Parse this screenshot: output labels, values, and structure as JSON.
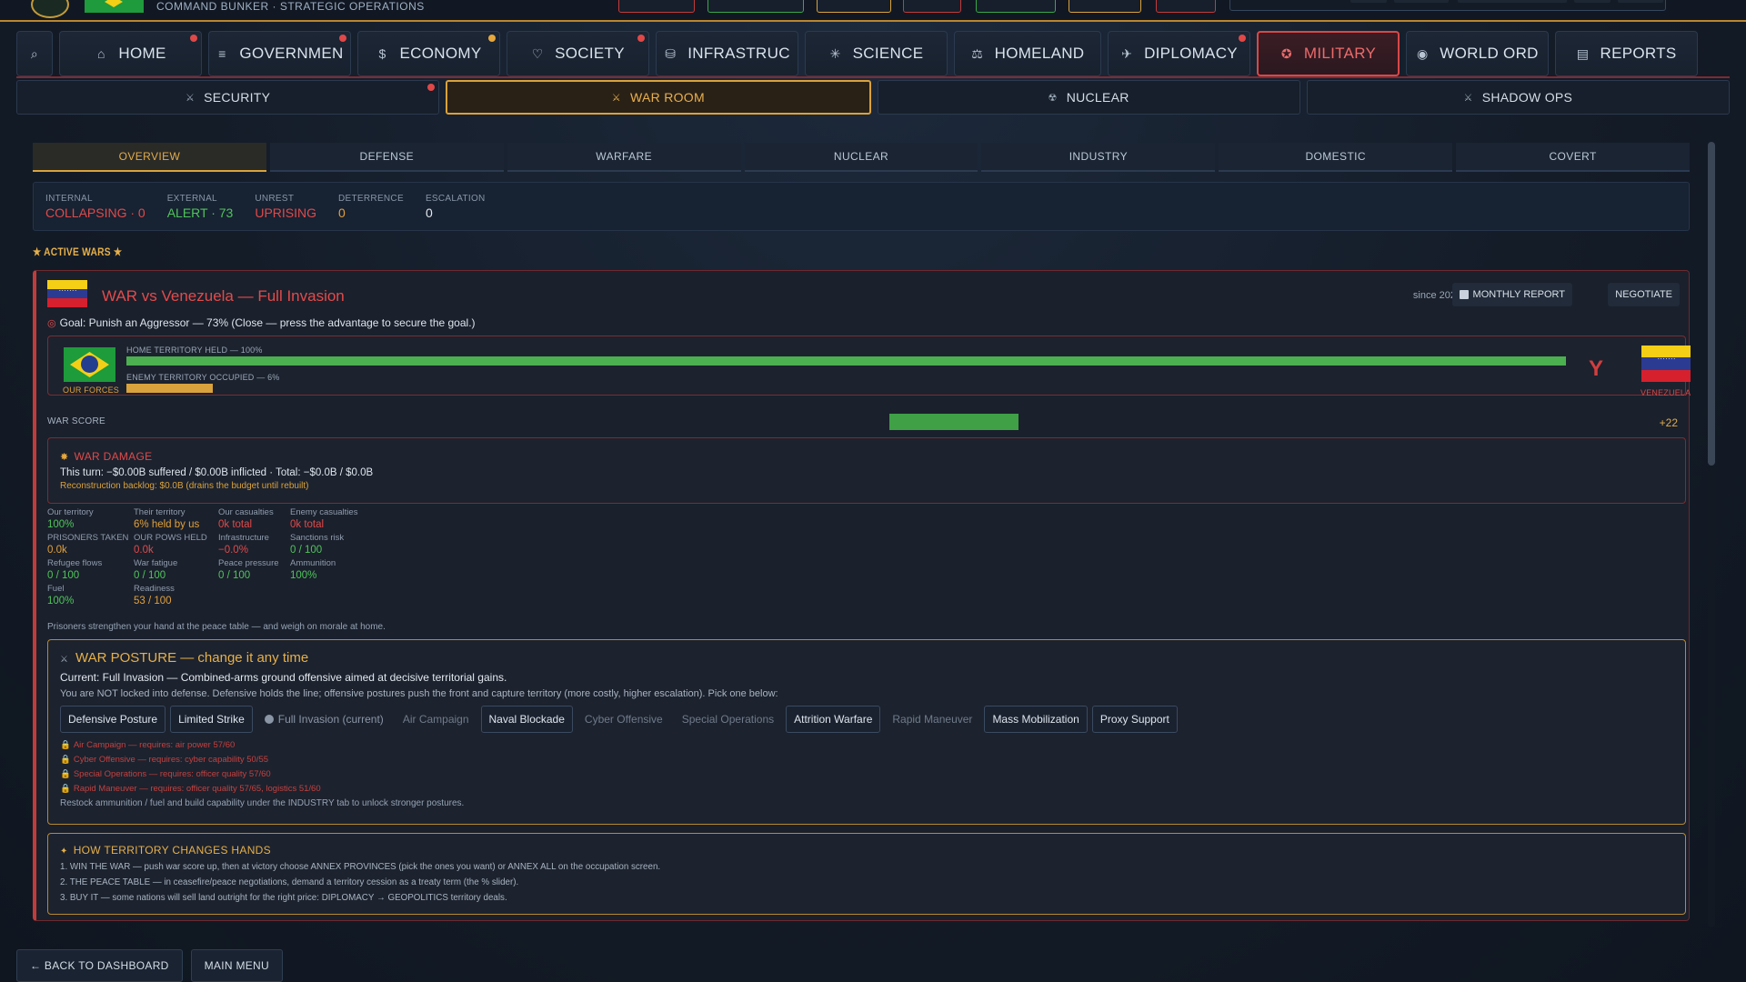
{
  "header": {
    "subtitle": "COMMAND BUNKER · STRATEGIC OPERATIONS",
    "chip_colors": [
      "#c23b3b",
      "#3aa64a",
      "#d9a23c",
      "#c23b3b",
      "#3aa64a",
      "#d9a23c",
      "#c23b3b"
    ]
  },
  "main_nav": {
    "search_icon": "search-icon",
    "items": [
      {
        "id": "home",
        "label": "HOME",
        "icon": "home-icon",
        "glyph": "⌂",
        "alert": "red"
      },
      {
        "id": "government",
        "label": "GOVERNMEN",
        "icon": "menu-icon",
        "glyph": "≡",
        "alert": "red"
      },
      {
        "id": "economy",
        "label": "ECONOMY",
        "icon": "dollar-icon",
        "glyph": "$",
        "alert": "amber"
      },
      {
        "id": "society",
        "label": "SOCIETY",
        "icon": "heart-icon",
        "glyph": "♡",
        "alert": "red"
      },
      {
        "id": "infrastructure",
        "label": "INFRASTRUC",
        "icon": "database-icon",
        "glyph": "⛁",
        "alert": ""
      },
      {
        "id": "science",
        "label": "SCIENCE",
        "icon": "atom-icon",
        "glyph": "✳",
        "alert": ""
      },
      {
        "id": "homeland",
        "label": "HOMELAND",
        "icon": "scales-icon",
        "glyph": "⚖",
        "alert": ""
      },
      {
        "id": "diplomacy",
        "label": "DIPLOMACY",
        "icon": "plane-icon",
        "glyph": "✈",
        "alert": "red"
      },
      {
        "id": "military",
        "label": "MILITARY",
        "icon": "target-icon",
        "glyph": "✪",
        "alert": "",
        "active": true
      },
      {
        "id": "world_order",
        "label": "WORLD ORD",
        "icon": "globe-icon",
        "glyph": "◉",
        "alert": ""
      },
      {
        "id": "reports",
        "label": "REPORTS",
        "icon": "document-icon",
        "glyph": "▤",
        "alert": ""
      }
    ]
  },
  "sub_nav": {
    "items": [
      {
        "id": "security",
        "label": "SECURITY",
        "icon": "swords-icon",
        "glyph": "⚔",
        "alert": "red"
      },
      {
        "id": "war_room",
        "label": "WAR ROOM",
        "icon": "swords-icon",
        "glyph": "⚔",
        "active": true
      },
      {
        "id": "nuclear",
        "label": "NUCLEAR",
        "icon": "radiation-icon",
        "glyph": "☢"
      },
      {
        "id": "shadow_ops",
        "label": "SHADOW OPS",
        "icon": "swords-icon",
        "glyph": "⚔"
      }
    ]
  },
  "tabs": [
    "OVERVIEW",
    "DEFENSE",
    "WARFARE",
    "NUCLEAR",
    "INDUSTRY",
    "DOMESTIC",
    "COVERT"
  ],
  "active_tab": "OVERVIEW",
  "status": [
    {
      "label": "INTERNAL",
      "value": "COLLAPSING · 0",
      "color": "red"
    },
    {
      "label": "EXTERNAL",
      "value": "ALERT · 73",
      "color": "green"
    },
    {
      "label": "UNREST",
      "value": "UPRISING",
      "color": "red"
    },
    {
      "label": "DETERRENCE",
      "value": "0",
      "color": "amber"
    },
    {
      "label": "ESCALATION",
      "value": "0",
      "color": "white"
    }
  ],
  "active_wars_label": "★ ACTIVE WARS ★",
  "war": {
    "title": "WAR vs Venezuela — Full Invasion",
    "since": "since 2029-01",
    "monthly_report_label": "MONTHLY REPORT",
    "negotiate_label": "NEGOTIATE",
    "goal": "Goal: Punish an Aggressor — 73% (Close — press the advantage to secure the goal.)",
    "our_forces_label": "OUR FORCES",
    "enemy_name": "VENEZUELA",
    "home_territory_label": "HOME TERRITORY HELD — 100%",
    "home_territory_pct": 100,
    "enemy_territory_label": "ENEMY TERRITORY OCCUPIED — 6%",
    "enemy_territory_pct": 6,
    "vs_mark": "Y",
    "war_score_label": "WAR SCORE",
    "war_score_value": "+22",
    "war_score_num": 22,
    "damage": {
      "header": "WAR DAMAGE",
      "this_turn": "This turn: −$0.00B suffered / $0.00B inflicted   ·   Total: −$0.0B / $0.0B",
      "backlog": "Reconstruction backlog: $0.0B (drains the budget until rebuilt)"
    },
    "stats": [
      {
        "k": "Our territory",
        "v": "100%",
        "c": "green"
      },
      {
        "k": "Their territory",
        "v": "6% held by us",
        "c": "amber"
      },
      {
        "k": "Our casualties",
        "v": "0k total",
        "c": "red"
      },
      {
        "k": "Enemy casualties",
        "v": "0k total",
        "c": "red"
      },
      {
        "k": "PRISONERS TAKEN",
        "v": "0.0k",
        "c": "amber"
      },
      {
        "k": "OUR POWS HELD",
        "v": "0.0k",
        "c": "red"
      },
      {
        "k": "Infrastructure",
        "v": "−0.0%",
        "c": "red"
      },
      {
        "k": "Sanctions risk",
        "v": "0 / 100",
        "c": "green"
      },
      {
        "k": "Refugee flows",
        "v": "0 / 100",
        "c": "green"
      },
      {
        "k": "War fatigue",
        "v": "0 / 100",
        "c": "green"
      },
      {
        "k": "Peace pressure",
        "v": "0 / 100",
        "c": "green"
      },
      {
        "k": "Ammunition",
        "v": "100%",
        "c": "green"
      },
      {
        "k": "Fuel",
        "v": "100%",
        "c": "green"
      },
      {
        "k": "Readiness",
        "v": "53 / 100",
        "c": "amber"
      }
    ],
    "prisoners_note": "Prisoners strengthen your hand at the peace table — and weigh on morale at home.",
    "posture": {
      "header": "WAR POSTURE — change it any time",
      "current": "Current: Full Invasion — Combined-arms ground offensive aimed at decisive territorial gains.",
      "note": "You are NOT locked into defense. Defensive holds the line; offensive postures push the front and capture territory (more costly, higher escalation). Pick one below:",
      "options": [
        {
          "label": "Defensive Posture",
          "state": "on"
        },
        {
          "label": "Limited Strike",
          "state": "on"
        },
        {
          "label": "Full Invasion (current)",
          "state": "current"
        },
        {
          "label": "Air Campaign",
          "state": "off"
        },
        {
          "label": "Naval Blockade",
          "state": "on"
        },
        {
          "label": "Cyber Offensive",
          "state": "off"
        },
        {
          "label": "Special Operations",
          "state": "off"
        },
        {
          "label": "Attrition Warfare",
          "state": "on"
        },
        {
          "label": "Rapid Maneuver",
          "state": "off"
        },
        {
          "label": "Mass Mobilization",
          "state": "on"
        },
        {
          "label": "Proxy Support",
          "state": "on"
        }
      ],
      "locks": [
        "Air Campaign — requires: air power 57/60",
        "Cyber Offensive — requires: cyber capability 50/55",
        "Special Operations — requires: officer quality 57/60",
        "Rapid Maneuver — requires: officer quality 57/65, logistics 51/60"
      ],
      "restock": "Restock ammunition / fuel and build capability under the INDUSTRY tab to unlock stronger postures."
    },
    "territory_help": {
      "header": "HOW TERRITORY CHANGES HANDS",
      "lines": [
        "1. WIN THE WAR — push war score up, then at victory choose ANNEX PROVINCES (pick the ones you want) or ANNEX ALL on the occupation screen.",
        "2. THE PEACE TABLE — in ceasefire/peace negotiations, demand a territory cession as a treaty term (the % slider).",
        "3. BUY IT — some nations will sell land outright for the right price: DIPLOMACY → GEOPOLITICS territory deals."
      ]
    }
  },
  "bottom": {
    "back_label": "← BACK TO DASHBOARD",
    "menu_label": "MAIN MENU"
  }
}
